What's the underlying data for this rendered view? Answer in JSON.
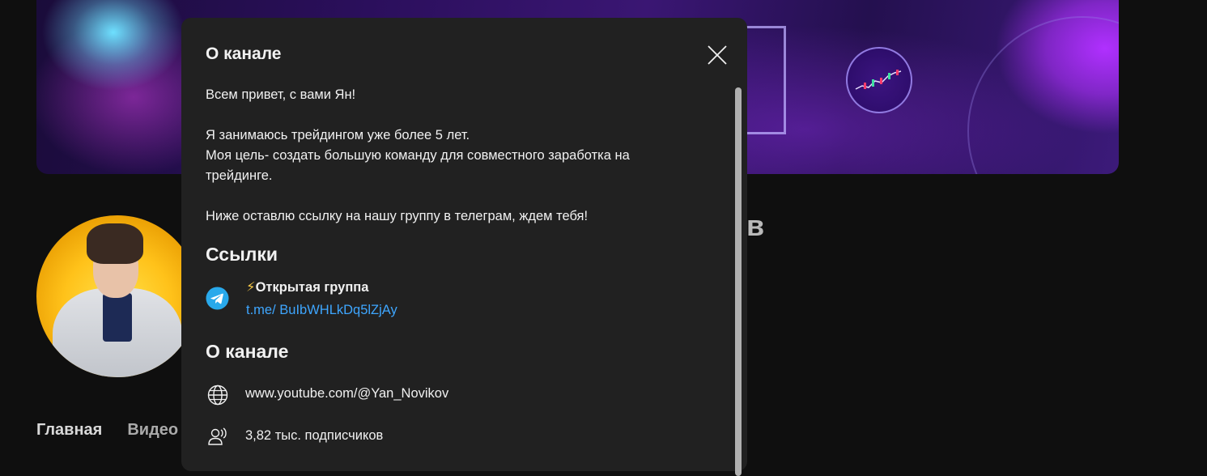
{
  "page": {
    "channel_name_tail": "в",
    "tabs": [
      {
        "label": "Главная",
        "active": true
      },
      {
        "label": "Видео",
        "active": false
      }
    ]
  },
  "dialog": {
    "title": "О канале",
    "description_lines": [
      "Всем привет, с вами Ян!",
      "",
      "Я занимаюсь трейдингом уже более 5 лет.",
      "Моя цель- создать большую команду для совместного заработка на",
      "трейдинге.",
      "",
      "Ниже оставлю ссылку на нашу группу в телеграм, ждем тебя!"
    ],
    "links_heading": "Ссылки",
    "links": [
      {
        "icon": "telegram-icon",
        "emoji": "⚡",
        "title": "Открытая группа",
        "url": "t.me/ BuIbWHLkDq5lZjAy"
      }
    ],
    "about_heading": "О канале",
    "details": {
      "channel_url": "www.youtube.com/@Yan_Novikov",
      "subscribers": "3,82 тыс. подписчиков"
    }
  },
  "colors": {
    "dialog_bg": "#212121",
    "page_bg": "#0f0f0f",
    "link": "#3ea6ff",
    "telegram": "#29a9eb"
  }
}
